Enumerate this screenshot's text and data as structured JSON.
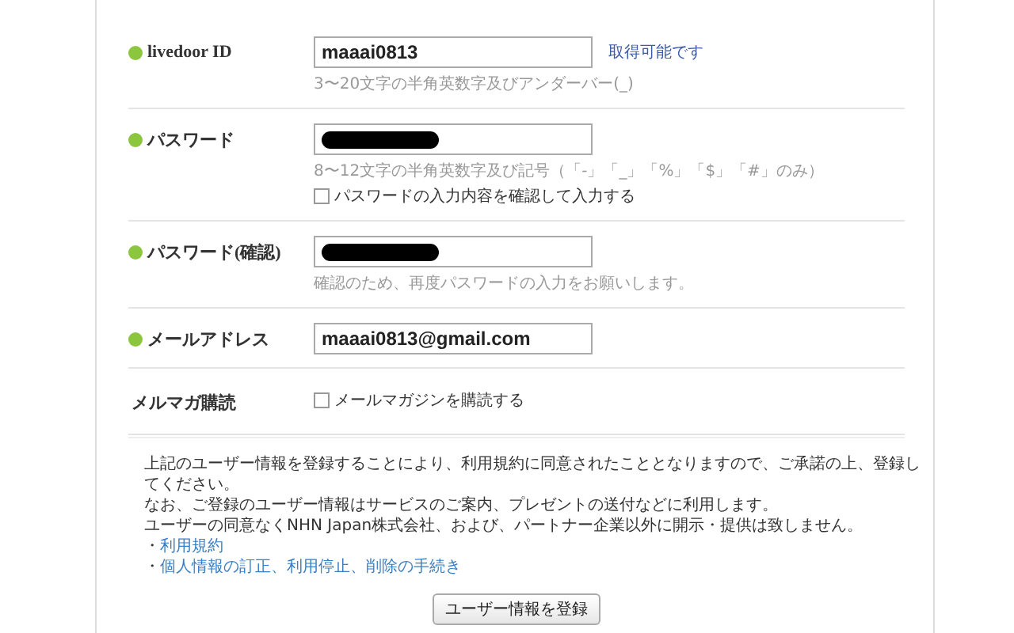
{
  "fields": [
    {
      "kind": "text",
      "label": "livedoor ID",
      "required": true,
      "value": "maaai0813",
      "status": "取得可能です",
      "hint": "3〜20文字の半角英数字及びアンダーバー(_)"
    },
    {
      "kind": "password",
      "label": "パスワード",
      "required": true,
      "redacted": true,
      "hint": "8〜12文字の半角英数字及び記号（「-」「_」「%」「$」「#」のみ）",
      "checkbox": {
        "label": "パスワードの入力内容を確認して入力する",
        "checked": false
      }
    },
    {
      "kind": "password",
      "label": "パスワード(確認)",
      "required": true,
      "redacted": true,
      "hint": "確認のため、再度パスワードの入力をお願いします。"
    },
    {
      "kind": "text",
      "label": "メールアドレス",
      "required": true,
      "value": "maaai0813@gmail.com"
    },
    {
      "kind": "checkbox",
      "label": "メルマガ購読",
      "required": false,
      "checkbox": {
        "label": "メールマガジンを購読する",
        "checked": false
      }
    }
  ],
  "notice": [
    "上記のユーザー情報を登録することにより、利用規約に同意されたこととなりますので、ご承諾の上、登録してください。",
    "なお、ご登録のユーザー情報はサービスのご案内、プレゼントの送付などに利用します。",
    "ユーザーの同意なくNHN Japan株式会社、および、パートナー企業以外に開示・提供は致しません。"
  ],
  "links": [
    {
      "bullet": "・",
      "label": "利用規約"
    },
    {
      "bullet": "・",
      "label": "個人情報の訂正、利用停止、削除の手続き"
    }
  ],
  "submit": "ユーザー情報を登録"
}
